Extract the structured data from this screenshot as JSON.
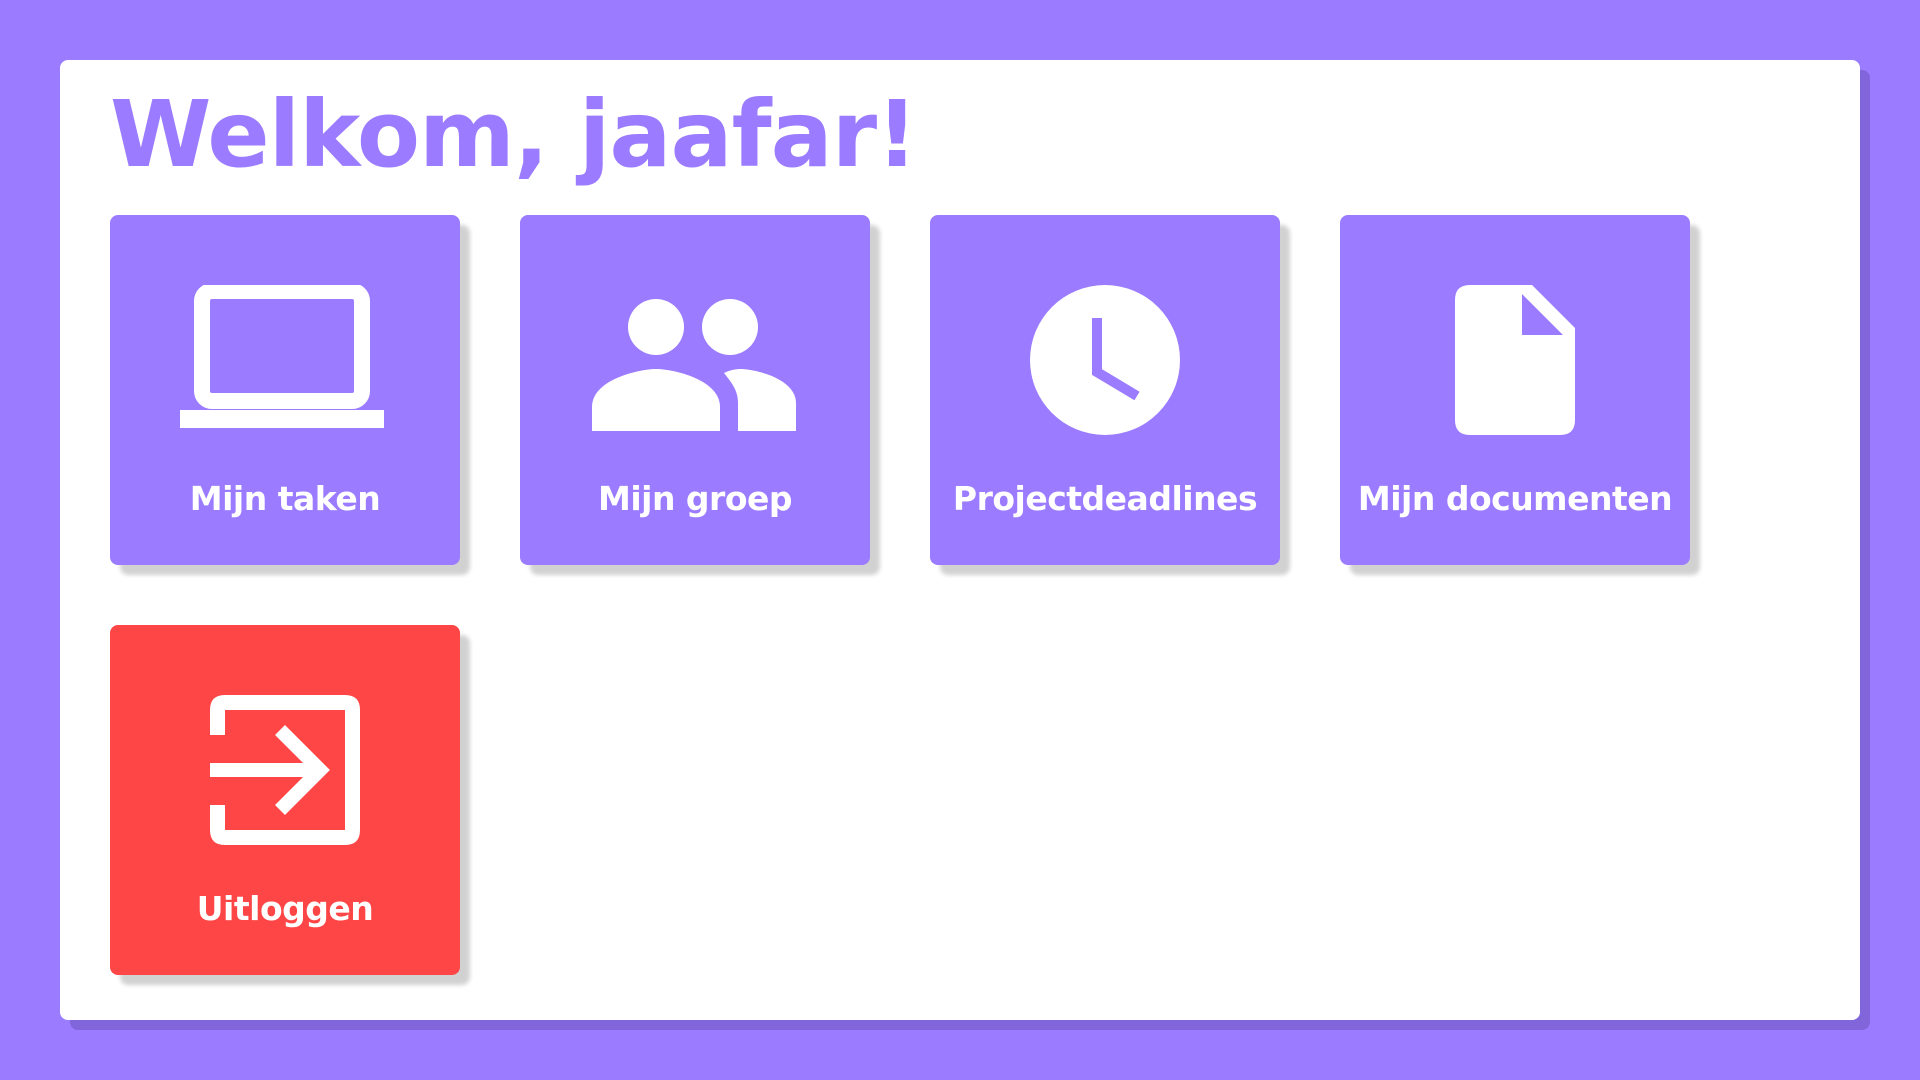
{
  "header": {
    "title": "Welkom, jaafar!"
  },
  "tiles": [
    {
      "label": "Mijn taken",
      "icon": "laptop-icon"
    },
    {
      "label": "Mijn groep",
      "icon": "group-icon"
    },
    {
      "label": "Projectdeadlines",
      "icon": "clock-icon"
    },
    {
      "label": "Mijn documenten",
      "icon": "document-icon"
    },
    {
      "label": "Uitloggen",
      "icon": "logout-icon"
    }
  ],
  "colors": {
    "background": "#9b7bff",
    "accent": "#9b7bff",
    "logout": "#ff4646",
    "panel": "#ffffff"
  }
}
